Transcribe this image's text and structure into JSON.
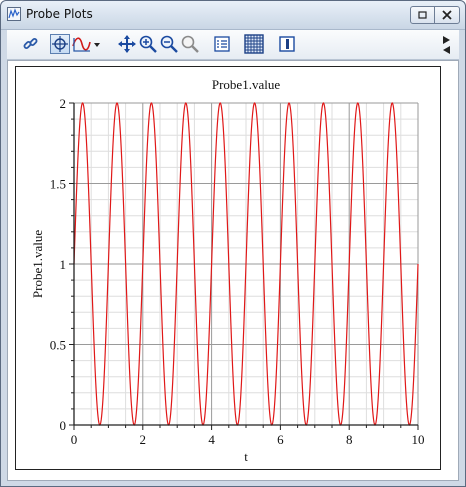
{
  "window": {
    "title": "Probe Plots"
  },
  "toolbar": {
    "buttons": [
      {
        "name": "link-icon"
      },
      {
        "name": "crosshair-probe-icon"
      },
      {
        "name": "curve-style-dropdown-icon"
      },
      {
        "name": "pan-icon"
      },
      {
        "name": "zoom-in-icon"
      },
      {
        "name": "zoom-out-icon"
      },
      {
        "name": "zoom-extents-icon"
      },
      {
        "name": "legend-list-icon"
      },
      {
        "name": "grid-toggle-icon"
      },
      {
        "name": "split-view-icon"
      }
    ]
  },
  "colors": {
    "series": "#e01818",
    "major_grid": "#9a9a9a",
    "minor_grid": "#dedede"
  },
  "chart_data": {
    "type": "line",
    "title": "Probe1.value",
    "xlabel": "t",
    "ylabel": "Probe1.value",
    "xlim": [
      0,
      10
    ],
    "ylim": [
      0,
      2
    ],
    "x_ticks": [
      "0",
      "2",
      "4",
      "6",
      "8",
      "10"
    ],
    "y_ticks": [
      "0",
      "0.5",
      "1",
      "1.5",
      "2"
    ],
    "grid": true,
    "series": [
      {
        "function": "1 + sin(2*pi*t)",
        "t_start": 0,
        "t_end": 10,
        "samples": 1001
      }
    ]
  }
}
